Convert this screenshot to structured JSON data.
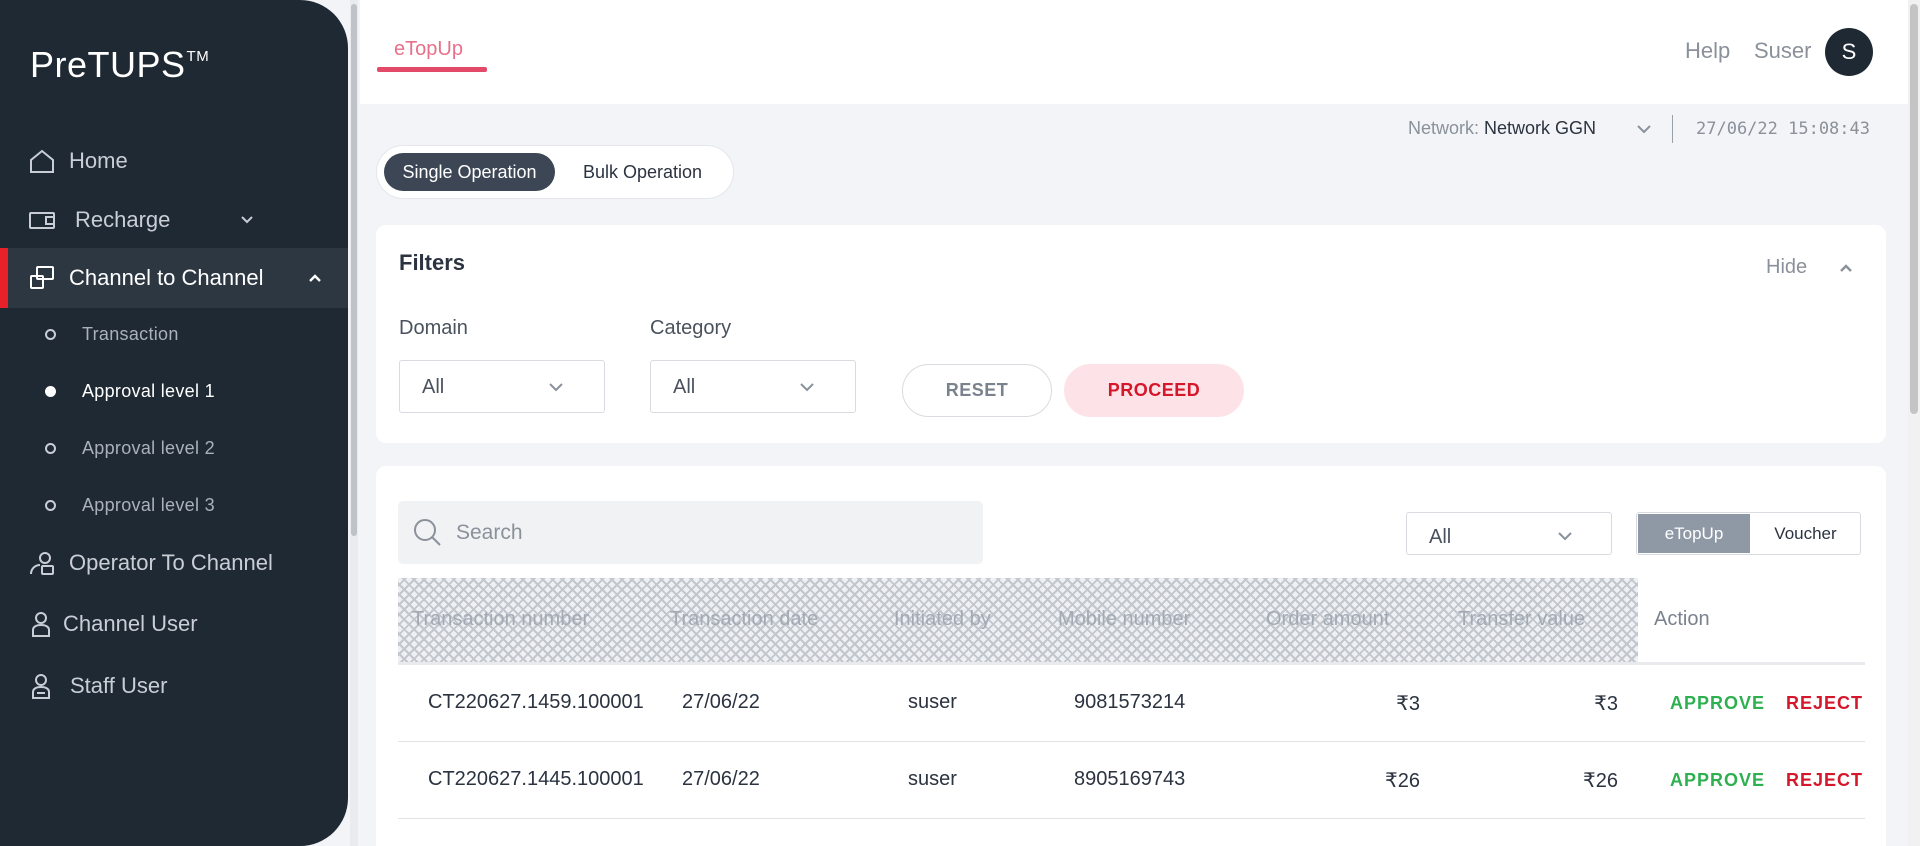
{
  "app": {
    "logo": "PreTUPS",
    "logo_tm": "TM"
  },
  "sidebar": {
    "items": [
      {
        "label": "Home",
        "icon": "home-icon"
      },
      {
        "label": "Recharge",
        "icon": "recharge-icon"
      },
      {
        "label": "Channel to Channel",
        "icon": "channel-transfer-icon",
        "active": true
      },
      {
        "label": "Operator To Channel",
        "icon": "operator-channel-icon"
      },
      {
        "label": "Channel User",
        "icon": "user-icon"
      },
      {
        "label": "Staff User",
        "icon": "staff-user-icon"
      }
    ],
    "subitems": [
      {
        "label": "Transaction"
      },
      {
        "label": "Approval level 1",
        "active": true
      },
      {
        "label": "Approval level 2"
      },
      {
        "label": "Approval level 3"
      }
    ]
  },
  "header": {
    "tab": "eTopUp",
    "help": "Help",
    "user": "Suser",
    "avatar_initial": "S"
  },
  "network": {
    "label": "Network:",
    "value": "Network GGN",
    "datetime": "27/06/22 15:08:43"
  },
  "operation_toggle": {
    "single": "Single Operation",
    "bulk": "Bulk Operation"
  },
  "filters": {
    "title": "Filters",
    "hide": "Hide",
    "domain_label": "Domain",
    "domain_value": "All",
    "category_label": "Category",
    "category_value": "All",
    "reset": "RESET",
    "proceed": "PROCEED"
  },
  "table": {
    "search_placeholder": "Search",
    "type_filter": "All",
    "segment": {
      "etopup": "eTopUp",
      "voucher": "Voucher"
    },
    "columns": [
      "Transaction number",
      "Transaction date",
      "Initiated by",
      "Mobile number",
      "Order amount",
      "Transfer value",
      "Action"
    ],
    "rows": [
      {
        "txn": "CT220627.1459.100001",
        "date": "27/06/22",
        "by": "suser",
        "mobile": "9081573214",
        "order": "₹3",
        "transfer": "₹3",
        "approve": "APPROVE",
        "reject": "REJECT"
      },
      {
        "txn": "CT220627.1445.100001",
        "date": "27/06/22",
        "by": "suser",
        "mobile": "8905169743",
        "order": "₹26",
        "transfer": "₹26",
        "approve": "APPROVE",
        "reject": "REJECT"
      }
    ]
  },
  "colors": {
    "sidebar_bg": "#1f2933",
    "accent_red": "#e8202a",
    "approve_green": "#2eb050",
    "reject_red": "#d5172b"
  }
}
